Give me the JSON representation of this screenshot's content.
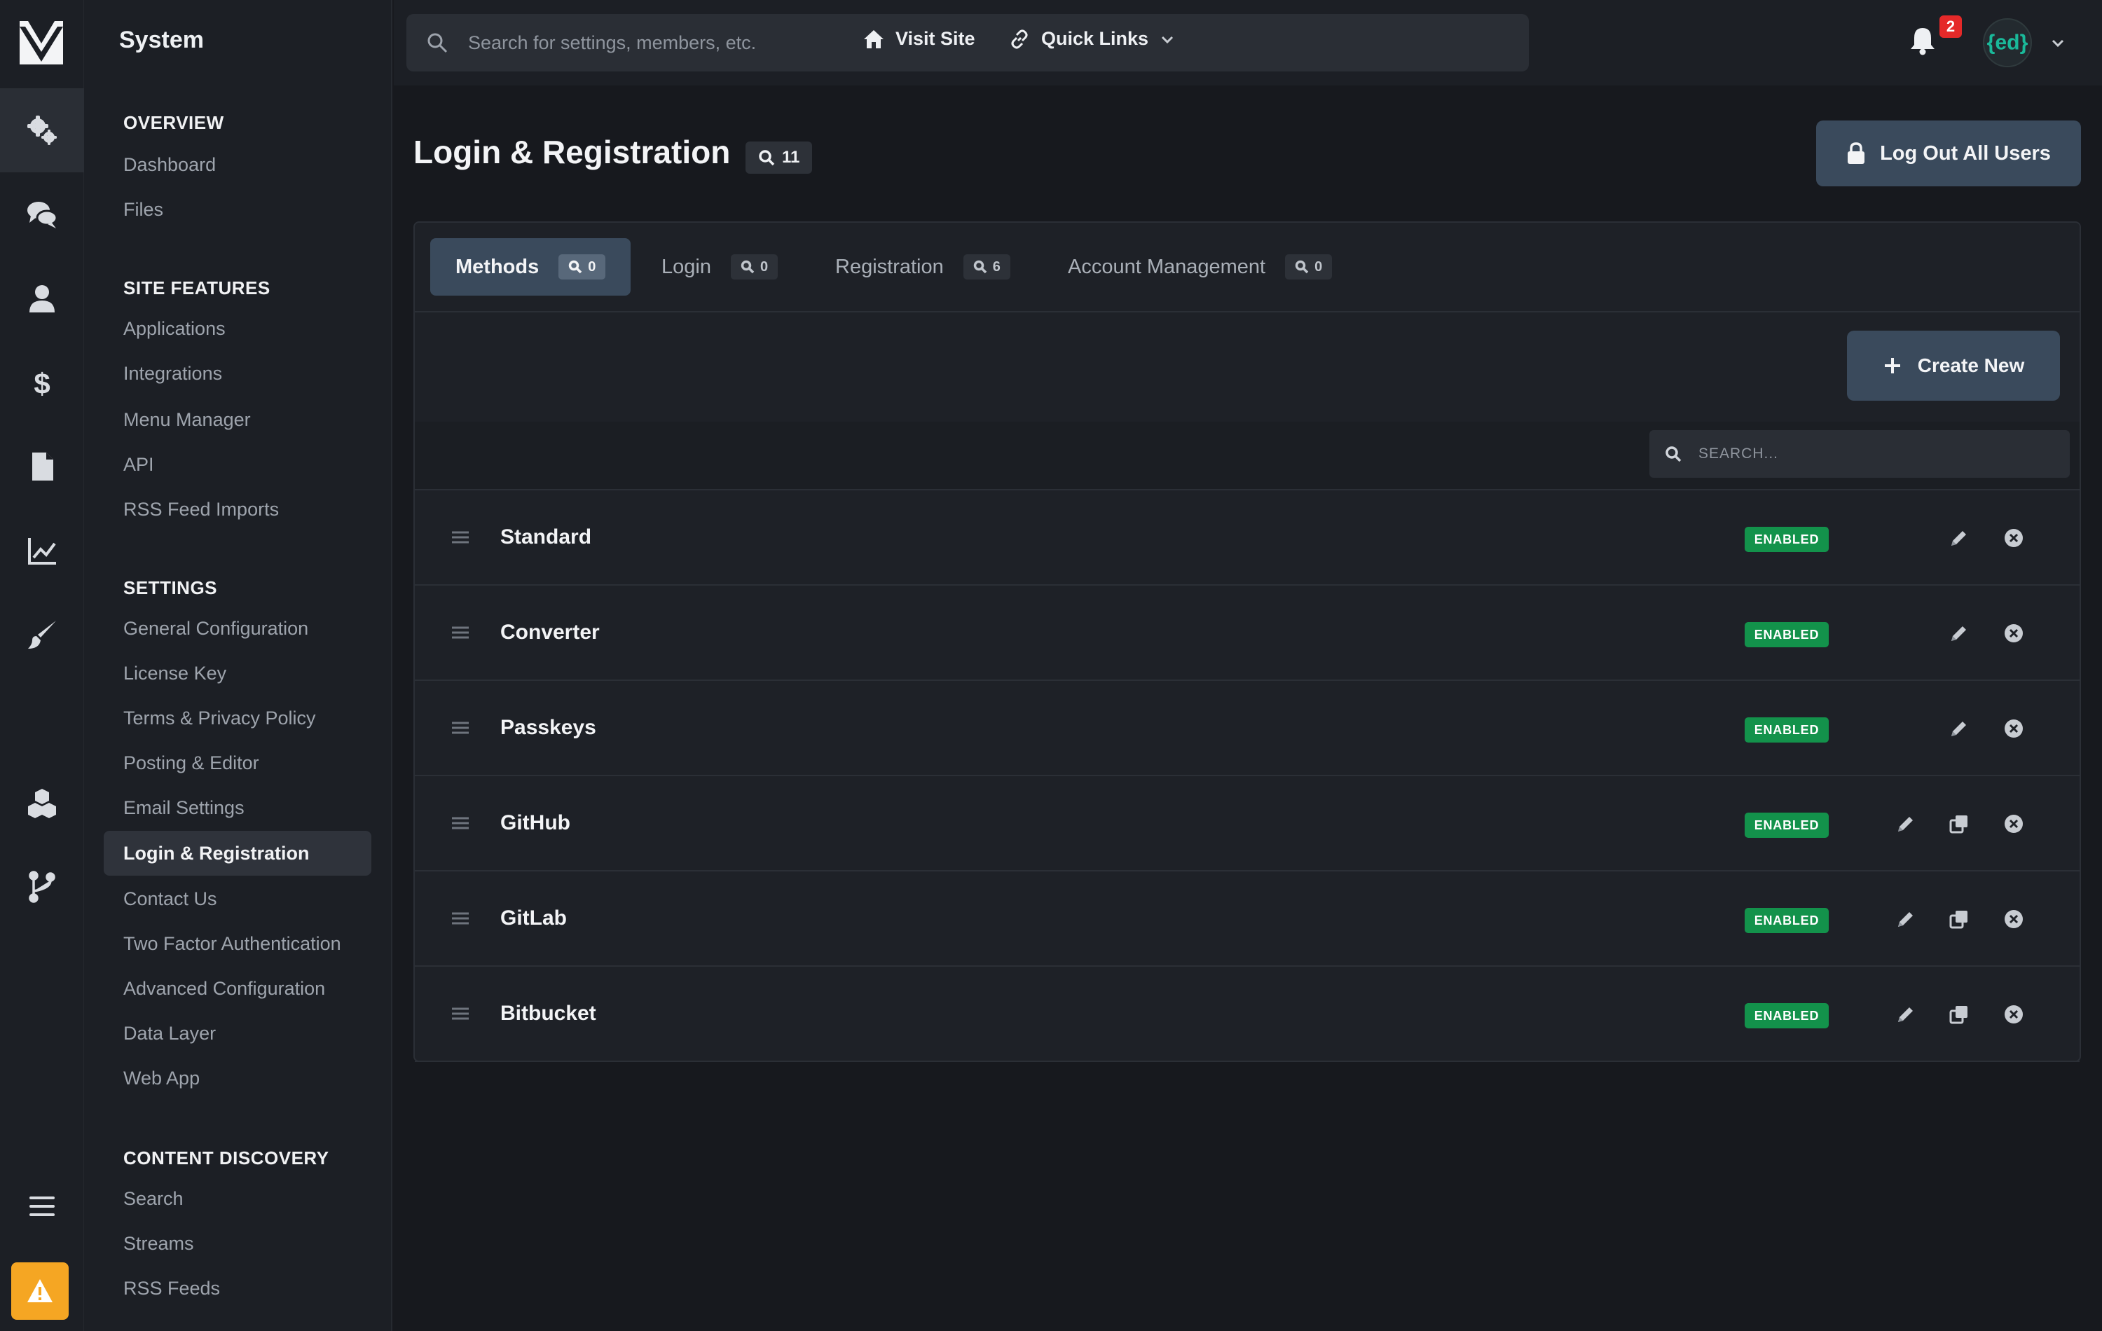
{
  "nav": {
    "title": "System",
    "sections": [
      {
        "label": "OVERVIEW",
        "links": [
          "Dashboard",
          "Files"
        ]
      },
      {
        "label": "SITE FEATURES",
        "links": [
          "Applications",
          "Integrations",
          "Menu Manager",
          "API",
          "RSS Feed Imports"
        ]
      },
      {
        "label": "SETTINGS",
        "links": [
          "General Configuration",
          "License Key",
          "Terms & Privacy Policy",
          "Posting & Editor",
          "Email Settings",
          "Login & Registration",
          "Contact Us",
          "Two Factor Authentication",
          "Advanced Configuration",
          "Data Layer",
          "Web App"
        ]
      },
      {
        "label": "CONTENT DISCOVERY",
        "links": [
          "Search",
          "Streams",
          "RSS Feeds"
        ]
      }
    ],
    "active_link": "Login & Registration"
  },
  "rail": {
    "items": [
      "gears-icon",
      "chat-icon",
      "user-icon",
      "dollar-icon",
      "document-icon",
      "chart-icon",
      "brush-icon",
      "cubes-icon",
      "branch-icon",
      "menu-icon"
    ],
    "warning_icon": "warning-icon"
  },
  "topbar": {
    "search_placeholder": "Search for settings, members, etc.",
    "visit_site": "Visit Site",
    "quick_links": "Quick Links",
    "notification_count": "2",
    "avatar_text": "{ed}"
  },
  "page": {
    "title": "Login & Registration",
    "count": "11",
    "logout_button": "Log Out All Users"
  },
  "tabs": [
    {
      "label": "Methods",
      "count": "0"
    },
    {
      "label": "Login",
      "count": "0"
    },
    {
      "label": "Registration",
      "count": "6"
    },
    {
      "label": "Account Management",
      "count": "0"
    }
  ],
  "table": {
    "create_button": "Create New",
    "search_placeholder": "SEARCH...",
    "rows": [
      {
        "name": "Standard",
        "status": "ENABLED",
        "copy": false
      },
      {
        "name": "Converter",
        "status": "ENABLED",
        "copy": false
      },
      {
        "name": "Passkeys",
        "status": "ENABLED",
        "copy": false
      },
      {
        "name": "GitHub",
        "status": "ENABLED",
        "copy": true
      },
      {
        "name": "GitLab",
        "status": "ENABLED",
        "copy": true
      },
      {
        "name": "Bitbucket",
        "status": "ENABLED",
        "copy": true
      }
    ]
  },
  "colors": {
    "accent": "#3a4a5c",
    "enabled": "#13924b",
    "warning": "#f5a623",
    "badge": "#e52929"
  }
}
